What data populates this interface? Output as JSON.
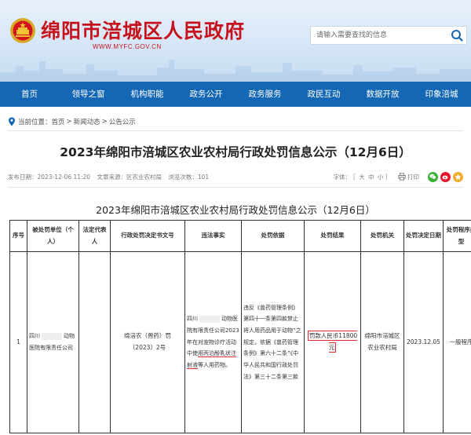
{
  "header": {
    "site_title": "绵阳市涪城区人民政府",
    "site_url": "WWW.MYFC.GOV.CN",
    "search_placeholder": "请输入需要查找的信息"
  },
  "nav": {
    "items": [
      "首页",
      "领导之窗",
      "机构职能",
      "政务公开",
      "政务服务",
      "政民互动",
      "数据开放",
      "印象涪城"
    ]
  },
  "breadcrumb": {
    "prefix": "当前位置：",
    "items": [
      "首页",
      "新闻动态",
      "公告公示"
    ]
  },
  "article": {
    "title": "2023年绵阳市涪城区农业农村局行政处罚信息公示（12月6日）",
    "publish_date": "发布日期：2023-12-06 11:20",
    "source": "文章来源：区农业农村局",
    "views": "浏览次数：101",
    "font_label": "字体：",
    "font_open": "［",
    "font_large": "大",
    "font_medium": "中",
    "font_small": "小",
    "font_close": "］",
    "print_label": "打印"
  },
  "share": {
    "wechat_color": "#3cb034",
    "weibo_color": "#e6162d",
    "qzone_color": "#f0ad2b"
  },
  "table": {
    "title": "2023年绵阳市涪城区农业农村局行政处罚信息公示（12月6日）",
    "headers": [
      "序号",
      "被处罚单位（个人）",
      "法定代表人",
      "行政处罚决定书文号",
      "违法事实",
      "处罚依据",
      "处罚结果",
      "处罚机关",
      "处罚决定日期",
      "处罚程序类型"
    ],
    "row": {
      "index": "1",
      "entity_a": "四川",
      "entity_b": "动物医院有限责任公司",
      "legal_rep": "",
      "doc_no": "绵涪农（兽药）罚〔2023〕2号",
      "facts_a": "四川",
      "facts_b": "动物医院有限责任公司2023年在对宠物诊疗活动中使",
      "facts_highlight": "用丙泊酚乳状注射液",
      "facts_c": "等人用药物。",
      "basis": "违反《兽药管理条例》第四十一条第四款禁止将人用药品用于动物”之规定，依据《兽药管理条例》第六十二条”《中华人民共和国行政处罚法》第三十二条第三款",
      "result_highlight": "罚款人民币11800元",
      "authority": "绵阳市涪城区农业农村局",
      "date": "2023.12.05",
      "procedure": "一般程序"
    }
  }
}
